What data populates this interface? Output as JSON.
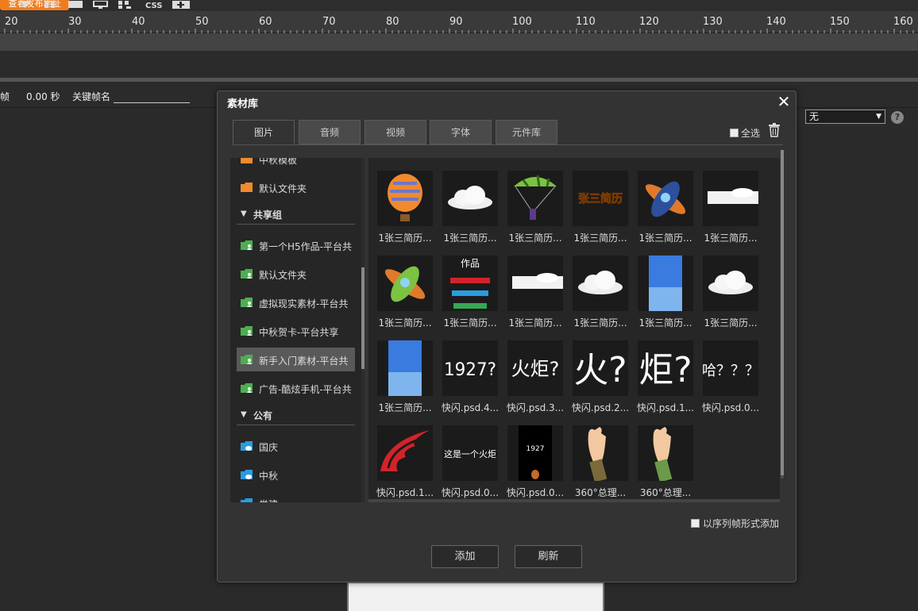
{
  "toolbar": {
    "orange_button": "查看发布地址"
  },
  "ruler": {
    "ticks": [
      "20",
      "30",
      "40",
      "50",
      "60",
      "70",
      "80",
      "90",
      "100",
      "110",
      "120",
      "130",
      "140",
      "150",
      "160"
    ]
  },
  "frame_row": {
    "frame_label": "帧",
    "time_value": "0.00 秒",
    "keyframe_name_label": "关键帧名"
  },
  "right_row": {
    "select_value": "无",
    "help": "?"
  },
  "dialog": {
    "title": "素材库",
    "tabs": [
      "图片",
      "音频",
      "视频",
      "字体",
      "元件库"
    ],
    "select_all": "全选",
    "sequence_label": "以序列帧形式添加",
    "add_button": "添加",
    "refresh_button": "刷新"
  },
  "folders": {
    "top_items": [
      {
        "label": "中秋模板",
        "color": "#f08a2d"
      },
      {
        "label": "默认文件夹",
        "color": "#f08a2d"
      }
    ],
    "shared_group": "共享组",
    "shared_items": [
      {
        "label": "第一个H5作品-平台共",
        "selected": false
      },
      {
        "label": "默认文件夹",
        "selected": false
      },
      {
        "label": "虚拟现实素材-平台共",
        "selected": false
      },
      {
        "label": "中秋贺卡-平台共享",
        "selected": false
      },
      {
        "label": "新手入门素材-平台共",
        "selected": true
      },
      {
        "label": "广告-酷炫手机-平台共",
        "selected": false
      }
    ],
    "public_group": "公有",
    "public_items": [
      {
        "label": "国庆"
      },
      {
        "label": "中秋"
      },
      {
        "label": "党建"
      }
    ]
  },
  "images": [
    {
      "caption": "1张三简历...",
      "icon": "hot-air-balloon"
    },
    {
      "caption": "1张三简历...",
      "icon": "cloud"
    },
    {
      "caption": "1张三简历...",
      "icon": "parachute"
    },
    {
      "caption": "1张三简历...",
      "icon": "title-text",
      "text": "张三简历"
    },
    {
      "caption": "1张三简历...",
      "icon": "airplane-blue"
    },
    {
      "caption": "1张三简历...",
      "icon": "cloud-flat"
    },
    {
      "caption": "1张三简历...",
      "icon": "airplane-green"
    },
    {
      "caption": "1张三简历...",
      "icon": "ribbon-list",
      "text": "作品"
    },
    {
      "caption": "1张三简历...",
      "icon": "cloud-flat"
    },
    {
      "caption": "1张三简历...",
      "icon": "cloud"
    },
    {
      "caption": "1张三简历...",
      "icon": "sky-gradient"
    },
    {
      "caption": "1张三简历...",
      "icon": "cloud"
    },
    {
      "caption": "1张三简历...",
      "icon": "sky-gradient"
    },
    {
      "caption": "快闪.psd.4...",
      "icon": "big-text",
      "text": "1927?"
    },
    {
      "caption": "快闪.psd.3...",
      "icon": "big-text",
      "text": "火炬?"
    },
    {
      "caption": "快闪.psd.2...",
      "icon": "big-text",
      "text": "火?"
    },
    {
      "caption": "快闪.psd.1...",
      "icon": "big-text",
      "text": "炬?"
    },
    {
      "caption": "快闪.psd.0...",
      "icon": "big-text",
      "text": "哈？？？"
    },
    {
      "caption": "快闪.psd.1...",
      "icon": "flame"
    },
    {
      "caption": "快闪.psd.0...",
      "icon": "small-text",
      "text": "这是一个火炬"
    },
    {
      "caption": "快闪.psd.0...",
      "icon": "poster",
      "text": "1927"
    },
    {
      "caption": "360°总理...",
      "icon": "hand-raise"
    },
    {
      "caption": "360°总理...",
      "icon": "hand-raise-green"
    }
  ]
}
